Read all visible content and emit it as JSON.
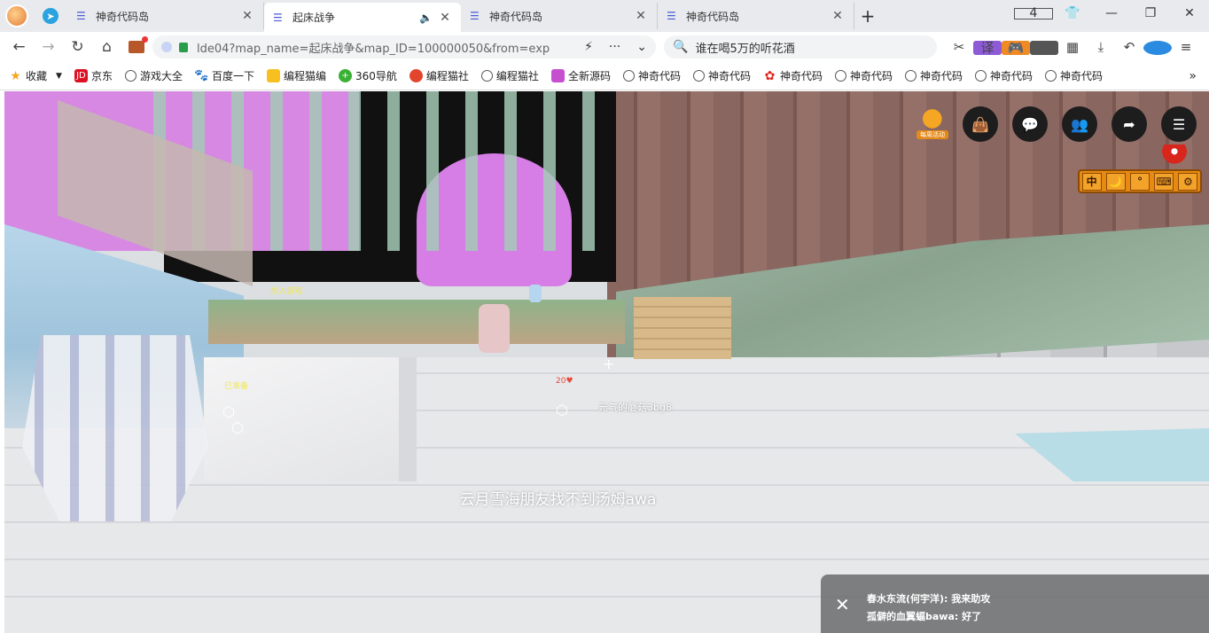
{
  "tabs": [
    {
      "title": "神奇代码岛",
      "active": false
    },
    {
      "title": "起床战争",
      "active": true
    },
    {
      "title": "神奇代码岛",
      "active": false
    },
    {
      "title": "神奇代码岛",
      "active": false
    }
  ],
  "window": {
    "tab_count": "4"
  },
  "navbar": {
    "url": "lde04?map_name=起床战争&map_ID=100000050&from=exp",
    "search_text": "谁在喝5万的听花酒"
  },
  "bookmarks": [
    {
      "label": "收藏",
      "icon": "star-icon"
    },
    {
      "label": "京东",
      "icon": "jd-icon"
    },
    {
      "label": "游戏大全",
      "icon": "globe-icon"
    },
    {
      "label": "百度一下",
      "icon": "baidu-icon"
    },
    {
      "label": "编程猫编",
      "icon": "codemao-icon"
    },
    {
      "label": "360导航",
      "icon": "360-icon"
    },
    {
      "label": "编程猫社",
      "icon": "codemao-community-icon"
    },
    {
      "label": "编程猫社",
      "icon": "globe-icon"
    },
    {
      "label": "全新源码",
      "icon": "source-icon"
    },
    {
      "label": "神奇代码",
      "icon": "globe-icon"
    },
    {
      "label": "神奇代码",
      "icon": "globe-icon"
    },
    {
      "label": "神奇代码",
      "icon": "huawei-icon"
    },
    {
      "label": "神奇代码",
      "icon": "globe-icon"
    },
    {
      "label": "神奇代码",
      "icon": "globe-icon"
    },
    {
      "label": "神奇代码",
      "icon": "globe-icon"
    },
    {
      "label": "神奇代码",
      "icon": "globe-icon"
    }
  ],
  "game": {
    "join_label": "加入游戏",
    "ready_label": "已准备",
    "hp_label": "20♥",
    "player_name": "元气的蘑菇3bg8",
    "center_message": "云月雪海朋友找不到汤姆awa",
    "event_label": "每周活动",
    "toolbar": [
      "中",
      "🌙",
      "°",
      "⌨",
      "⚙"
    ]
  },
  "chat": {
    "lines": [
      "春水东流(何宇洋): 我来助攻",
      "孤僻的血翼蝠bawa: 好了"
    ]
  },
  "colors": {
    "tab_bg": "#e8eaed",
    "accent": "#4a5ad8",
    "toolbar_orange": "#e78a12"
  }
}
